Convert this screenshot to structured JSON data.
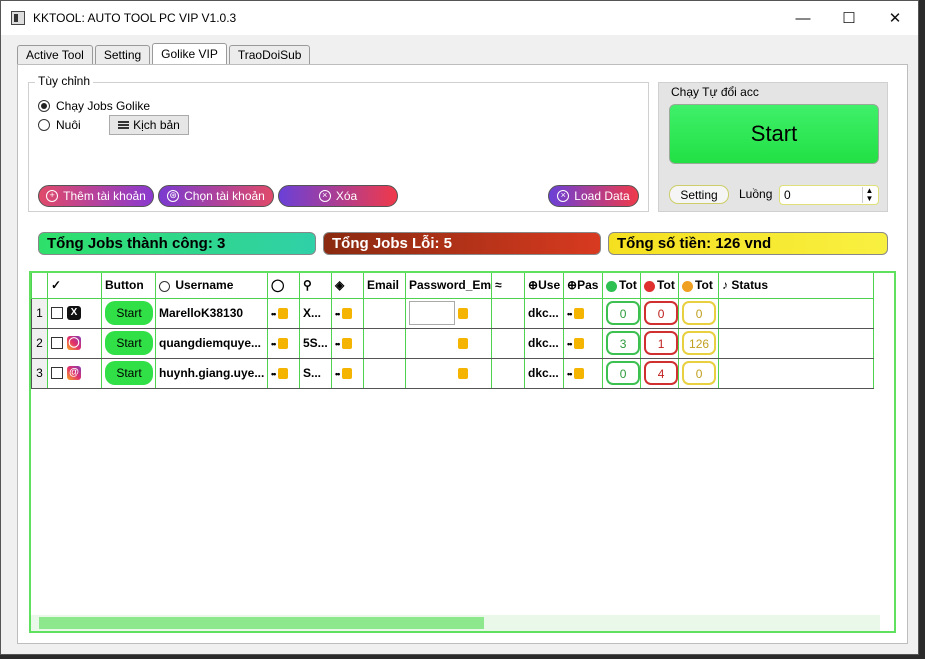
{
  "window": {
    "title": "KKTOOL: AUTO TOOL PC VIP V1.0.3"
  },
  "tabs": [
    "Active Tool",
    "Setting",
    "Golike VIP",
    "TraoDoiSub"
  ],
  "options": {
    "legend": "Tùy chỉnh",
    "radio1": "Chạy Jobs Golike",
    "radio2": "Nuôi",
    "script_button": "Kịch bản"
  },
  "actions": {
    "add": "Thêm tài khoản",
    "choose": "Chọn tài khoản",
    "delete": "Xóa",
    "load": "Load Data"
  },
  "auto": {
    "legend": "Chạy Tự đổi acc",
    "start": "Start",
    "setting": "Setting",
    "threads_label": "Luồng",
    "threads_value": "0"
  },
  "stats": {
    "success": "Tổng Jobs thành công: 3",
    "errors": "Tổng Jobs Lỗi: 5",
    "money": "Tổng số tiền: 126 vnd"
  },
  "table": {
    "headers": [
      "✓",
      "Button",
      "Username",
      "",
      "",
      "",
      "Email",
      "Password_Em",
      "",
      "Use",
      "Pas",
      "Tot",
      "Tot",
      "Tot",
      "Status"
    ],
    "rows": [
      {
        "n": "1",
        "platform": "X",
        "button": "Start",
        "username": "MarelloK38130",
        "pass": "••",
        "token": "X...",
        "cookie": "••",
        "email": "",
        "pwem": "",
        "proxy": "dkc...",
        "pas": "••",
        "ok": "0",
        "err": "0",
        "money": "0",
        "status": ""
      },
      {
        "n": "2",
        "platform": "IG",
        "button": "Start",
        "username": "quangdiemquye...",
        "pass": "••",
        "token": "5S...",
        "cookie": "••",
        "email": "",
        "pwem": "",
        "proxy": "dkc...",
        "pas": "••",
        "ok": "3",
        "err": "1",
        "money": "126",
        "status": ""
      },
      {
        "n": "3",
        "platform": "TH",
        "button": "Start",
        "username": "huynh.giang.uye...",
        "pass": "••",
        "token": "S...",
        "cookie": "••",
        "email": "",
        "pwem": "",
        "proxy": "dkc...",
        "pas": "••",
        "ok": "0",
        "err": "4",
        "money": "0",
        "status": ""
      }
    ]
  }
}
